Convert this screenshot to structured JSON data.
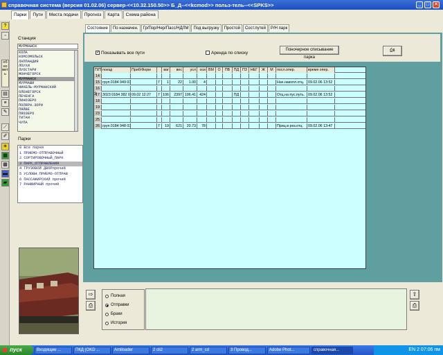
{
  "window": {
    "title": "справочная система (версия 01.02.06) сервер-<<10.32.150.50>> Б_Д--<<kcmod>> польз-тель--<<SPKS>>"
  },
  "top_tabs": [
    "Парки",
    "Пути",
    "Места подачи",
    "Прогноз",
    "Карта",
    "Схема района"
  ],
  "left_toolbar": {
    "vertical_label": "обновить"
  },
  "station": {
    "label": "Станция",
    "value": "МУРМАНСК",
    "items": [
      "КОЛА",
      "КОМСОМОЛЬСК",
      "ЛАППАНДИЯ",
      "ЛОУХИ",
      "ЛУОСТАРИ",
      "МОНЧЕГОРСК",
      "МУРМАНСК",
      "МУРМАШИ",
      "НИКЕЛЬ-МУРМАНСКИЙ",
      "ОЛЕНЕГОРСК",
      "ПЕЧЕНГА",
      "ПИНОЗЕРО",
      "ПОЛЯРН.ЗОРИ",
      "ПЯЙВЕ",
      "ПЯОЗЕРО",
      "ТИТАН",
      "ЧУПА"
    ],
    "selected": "МУРМАНСК"
  },
  "parks": {
    "label": "Парки",
    "items": [
      "0  Все парки",
      "1  ПРИЕМО-ОТПРАВОЧНЫЙ",
      "2  СОРТИРОВОЧНЫЙ_ПАРК",
      "3  ПАРК_ОТПРАВЛЕНИЯ",
      "4  ГРУЗОВОЙ ДВОРпрочий",
      "5  УСЛОВН.ПРИЕМО-ОТПРАВ",
      "6  ПАССАЖИРСКИЙ прочий",
      "7  РАНЖИРНЫЙ прочий"
    ],
    "selected": "3  ПАРК_ОТПРАВЛЕНИЯ"
  },
  "sub_tabs": [
    "Состояние",
    "По назначен.",
    "Гр/Пор/Нер/Пасс/НДЛМ",
    "Под выгрузку",
    "Простой",
    "Сост.путей",
    "Р/Н парк"
  ],
  "controls": {
    "show_all_tracks": "Показывать  все пути",
    "rent_by_list": "Аренда по списку",
    "wagon_list_button": "Поночерное списывание парка"
  },
  "table": {
    "headers": [
      "П/П",
      "поезд",
      "Приб/Форм",
      "",
      "ваг",
      "вес",
      "усл",
      "оси",
      "ВМ",
      "О",
      "ПВ",
      "ПД",
      "ПЗ",
      "НЕГ",
      "Ж",
      "М",
      "посл.опер.",
      "время опер."
    ],
    "rows": [
      [
        "14",
        "",
        "",
        "",
        "",
        "",
        "",
        "",
        "",
        "",
        "",
        "",
        "",
        "",
        "",
        "",
        "",
        ""
      ],
      [
        "15",
        "груп.0184 949 0315",
        "",
        "Г",
        "1",
        "22",
        "1.00",
        "4",
        "",
        "",
        "",
        "",
        "",
        "",
        "",
        "",
        "Нач.накопл.отц.",
        "09.02.06 13:52"
      ],
      [
        "16",
        "",
        "",
        "",
        "",
        "",
        "",
        "",
        "",
        "",
        "",
        "",
        "",
        "",
        "",
        "",
        "",
        ""
      ],
      [
        "17",
        "3023 0184 382 0163",
        "09.02 12:27",
        "Г",
        "106",
        "2397",
        "106.41",
        "424",
        "",
        "",
        "",
        "ПД",
        "",
        "",
        "",
        "",
        "Отц.на пус.путь.",
        "09.02.06 13:52"
      ],
      [
        "18",
        "",
        "",
        "",
        "",
        "",
        "",
        "",
        "",
        "",
        "",
        "",
        "",
        "",
        "",
        "",
        "",
        ""
      ],
      [
        "19",
        "",
        "",
        "",
        "",
        "",
        "",
        "",
        "",
        "",
        "",
        "",
        "",
        "",
        "",
        "",
        "",
        ""
      ],
      [
        "23",
        "",
        "",
        "",
        "",
        "",
        "",
        "",
        "",
        "",
        "",
        "",
        "",
        "",
        "",
        "",
        "",
        ""
      ],
      [
        "25",
        "",
        "",
        "",
        "",
        "",
        "",
        "",
        "",
        "",
        "",
        "",
        "",
        "",
        "",
        "",
        "",
        ""
      ],
      [
        "26",
        "груп.0184 948 0316",
        "",
        "Г",
        "19",
        "621",
        "20.73",
        "78",
        "",
        "",
        "",
        "",
        "",
        "",
        "",
        "",
        "Приц.в рез.отц.",
        "09.02.06 13:47"
      ]
    ],
    "marker": {
      "row": "17",
      "label": "3"
    }
  },
  "radio": {
    "options": [
      "Полная",
      "Отправки",
      "Браки",
      "История"
    ],
    "selected": "Отправки"
  },
  "taskbar": {
    "start": "пуск",
    "tasks": [
      "Входящие ...",
      "ПКД (OKD ...",
      "Amiloader",
      "2 cli2",
      "2 arm_cd",
      "3 Провод...",
      "Adobe Phot...",
      "справочная..."
    ],
    "tray": "EN   2 07:06 пм"
  }
}
